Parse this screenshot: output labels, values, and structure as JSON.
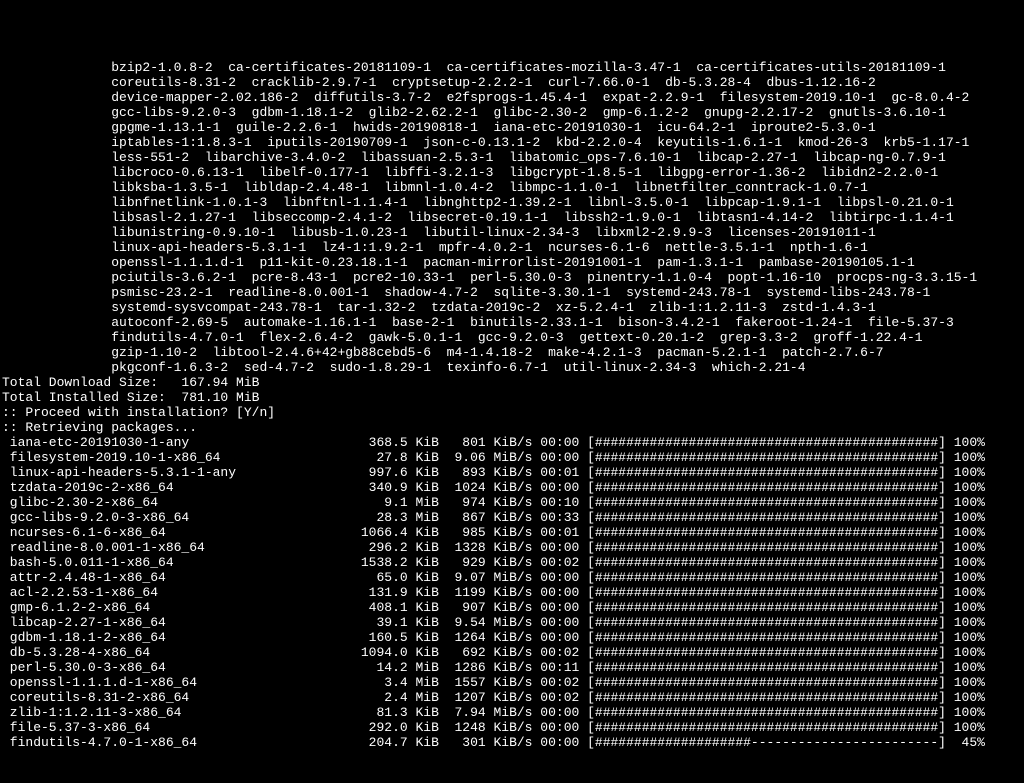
{
  "package_list_lines": [
    "              bzip2-1.0.8-2  ca-certificates-20181109-1  ca-certificates-mozilla-3.47-1  ca-certificates-utils-20181109-1",
    "              coreutils-8.31-2  cracklib-2.9.7-1  cryptsetup-2.2.2-1  curl-7.66.0-1  db-5.3.28-4  dbus-1.12.16-2",
    "              device-mapper-2.02.186-2  diffutils-3.7-2  e2fsprogs-1.45.4-1  expat-2.2.9-1  filesystem-2019.10-1  gc-8.0.4-2",
    "              gcc-libs-9.2.0-3  gdbm-1.18.1-2  glib2-2.62.2-1  glibc-2.30-2  gmp-6.1.2-2  gnupg-2.2.17-2  gnutls-3.6.10-1",
    "              gpgme-1.13.1-1  guile-2.2.6-1  hwids-20190818-1  iana-etc-20191030-1  icu-64.2-1  iproute2-5.3.0-1",
    "              iptables-1:1.8.3-1  iputils-20190709-1  json-c-0.13.1-2  kbd-2.2.0-4  keyutils-1.6.1-1  kmod-26-3  krb5-1.17-1",
    "              less-551-2  libarchive-3.4.0-2  libassuan-2.5.3-1  libatomic_ops-7.6.10-1  libcap-2.27-1  libcap-ng-0.7.9-1",
    "              libcroco-0.6.13-1  libelf-0.177-1  libffi-3.2.1-3  libgcrypt-1.8.5-1  libgpg-error-1.36-2  libidn2-2.2.0-1",
    "              libksba-1.3.5-1  libldap-2.4.48-1  libmnl-1.0.4-2  libmpc-1.1.0-1  libnetfilter_conntrack-1.0.7-1",
    "              libnfnetlink-1.0.1-3  libnftnl-1.1.4-1  libnghttp2-1.39.2-1  libnl-3.5.0-1  libpcap-1.9.1-1  libpsl-0.21.0-1",
    "              libsasl-2.1.27-1  libseccomp-2.4.1-2  libsecret-0.19.1-1  libssh2-1.9.0-1  libtasn1-4.14-2  libtirpc-1.1.4-1",
    "              libunistring-0.9.10-1  libusb-1.0.23-1  libutil-linux-2.34-3  libxml2-2.9.9-3  licenses-20191011-1",
    "              linux-api-headers-5.3.1-1  lz4-1:1.9.2-1  mpfr-4.0.2-1  ncurses-6.1-6  nettle-3.5.1-1  npth-1.6-1",
    "              openssl-1.1.1.d-1  p11-kit-0.23.18.1-1  pacman-mirrorlist-20191001-1  pam-1.3.1-1  pambase-20190105.1-1",
    "              pciutils-3.6.2-1  pcre-8.43-1  pcre2-10.33-1  perl-5.30.0-3  pinentry-1.1.0-4  popt-1.16-10  procps-ng-3.3.15-1",
    "              psmisc-23.2-1  readline-8.0.001-1  shadow-4.7-2  sqlite-3.30.1-1  systemd-243.78-1  systemd-libs-243.78-1",
    "              systemd-sysvcompat-243.78-1  tar-1.32-2  tzdata-2019c-2  xz-5.2.4-1  zlib-1:1.2.11-3  zstd-1.4.3-1",
    "              autoconf-2.69-5  automake-1.16.1-1  base-2-1  binutils-2.33.1-1  bison-3.4.2-1  fakeroot-1.24-1  file-5.37-3",
    "              findutils-4.7.0-1  flex-2.6.4-2  gawk-5.0.1-1  gcc-9.2.0-3  gettext-0.20.1-2  grep-3.3-2  groff-1.22.4-1",
    "              gzip-1.10-2  libtool-2.4.6+42+gb88cebd5-6  m4-1.4.18-2  make-4.2.1-3  pacman-5.2.1-1  patch-2.7.6-7",
    "              pkgconf-1.6.3-2  sed-4.7-2  sudo-1.8.29-1  texinfo-6.7-1  util-linux-2.34-3  which-2.21-4"
  ],
  "sizes": {
    "download_label": "Total Download Size:   ",
    "download_value": "167.94 MiB",
    "installed_label": "Total Installed Size:  ",
    "installed_value": "781.10 MiB"
  },
  "prompts": {
    "proceed": ":: Proceed with installation? [Y/n]",
    "retrieving": ":: Retrieving packages..."
  },
  "progress_bar_width": 44,
  "downloads": [
    {
      "name": " iana-etc-20191030-1-any",
      "size": " 368.5 KiB",
      "speed": "  801 KiB/s",
      "time": "00:00",
      "pct": 100
    },
    {
      "name": " filesystem-2019.10-1-x86_64",
      "size": "  27.8 KiB",
      "speed": " 9.06 MiB/s",
      "time": "00:00",
      "pct": 100
    },
    {
      "name": " linux-api-headers-5.3.1-1-any",
      "size": " 997.6 KiB",
      "speed": "  893 KiB/s",
      "time": "00:01",
      "pct": 100
    },
    {
      "name": " tzdata-2019c-2-x86_64",
      "size": " 340.9 KiB",
      "speed": " 1024 KiB/s",
      "time": "00:00",
      "pct": 100
    },
    {
      "name": " glibc-2.30-2-x86_64",
      "size": "   9.1 MiB",
      "speed": "  974 KiB/s",
      "time": "00:10",
      "pct": 100
    },
    {
      "name": " gcc-libs-9.2.0-3-x86_64",
      "size": "  28.3 MiB",
      "speed": "  867 KiB/s",
      "time": "00:33",
      "pct": 100
    },
    {
      "name": " ncurses-6.1-6-x86_64",
      "size": "1066.4 KiB",
      "speed": "  985 KiB/s",
      "time": "00:01",
      "pct": 100
    },
    {
      "name": " readline-8.0.001-1-x86_64",
      "size": " 296.2 KiB",
      "speed": " 1328 KiB/s",
      "time": "00:00",
      "pct": 100
    },
    {
      "name": " bash-5.0.011-1-x86_64",
      "size": "1538.2 KiB",
      "speed": "  929 KiB/s",
      "time": "00:02",
      "pct": 100
    },
    {
      "name": " attr-2.4.48-1-x86_64",
      "size": "  65.0 KiB",
      "speed": " 9.07 MiB/s",
      "time": "00:00",
      "pct": 100
    },
    {
      "name": " acl-2.2.53-1-x86_64",
      "size": " 131.9 KiB",
      "speed": " 1199 KiB/s",
      "time": "00:00",
      "pct": 100
    },
    {
      "name": " gmp-6.1.2-2-x86_64",
      "size": " 408.1 KiB",
      "speed": "  907 KiB/s",
      "time": "00:00",
      "pct": 100
    },
    {
      "name": " libcap-2.27-1-x86_64",
      "size": "  39.1 KiB",
      "speed": " 9.54 MiB/s",
      "time": "00:00",
      "pct": 100
    },
    {
      "name": " gdbm-1.18.1-2-x86_64",
      "size": " 160.5 KiB",
      "speed": " 1264 KiB/s",
      "time": "00:00",
      "pct": 100
    },
    {
      "name": " db-5.3.28-4-x86_64",
      "size": "1094.0 KiB",
      "speed": "  692 KiB/s",
      "time": "00:02",
      "pct": 100
    },
    {
      "name": " perl-5.30.0-3-x86_64",
      "size": "  14.2 MiB",
      "speed": " 1286 KiB/s",
      "time": "00:11",
      "pct": 100
    },
    {
      "name": " openssl-1.1.1.d-1-x86_64",
      "size": "   3.4 MiB",
      "speed": " 1557 KiB/s",
      "time": "00:02",
      "pct": 100
    },
    {
      "name": " coreutils-8.31-2-x86_64",
      "size": "   2.4 MiB",
      "speed": " 1207 KiB/s",
      "time": "00:02",
      "pct": 100
    },
    {
      "name": " zlib-1:1.2.11-3-x86_64",
      "size": "  81.3 KiB",
      "speed": " 7.94 MiB/s",
      "time": "00:00",
      "pct": 100
    },
    {
      "name": " file-5.37-3-x86_64",
      "size": " 292.0 KiB",
      "speed": " 1248 KiB/s",
      "time": "00:00",
      "pct": 100
    },
    {
      "name": " findutils-4.7.0-1-x86_64",
      "size": " 204.7 KiB",
      "speed": "  301 KiB/s",
      "time": "00:00",
      "pct": 45
    }
  ]
}
